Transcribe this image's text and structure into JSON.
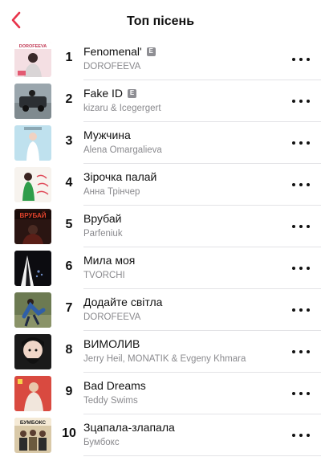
{
  "header": {
    "title": "Топ пісень",
    "back_icon": "chevron-left-icon",
    "accent": "#e8334a"
  },
  "explicit_badge": "E",
  "more_icon": "ellipsis-icon",
  "songs": [
    {
      "rank": "1",
      "title": "Fenomenal'",
      "artist": "DOROFEEVA",
      "explicit": true,
      "art_label": "DOROFEEVA",
      "art_bg": "#f4dfe3",
      "art_fg": "#c23a55"
    },
    {
      "rank": "2",
      "title": "Fake ID",
      "artist": "kizaru & Icegergert",
      "explicit": true,
      "art_label": "",
      "art_bg": "#9aa6ad",
      "art_fg": "#2b2f33"
    },
    {
      "rank": "3",
      "title": "Мужчина",
      "artist": "Alena Omargalieva",
      "explicit": false,
      "art_label": "",
      "art_bg": "#bfe1ee",
      "art_fg": "#ffffff"
    },
    {
      "rank": "4",
      "title": "Зірочка палай",
      "artist": "Анна Трінчер",
      "explicit": false,
      "art_label": "",
      "art_bg": "#f7f3ee",
      "art_fg": "#2f9d4a"
    },
    {
      "rank": "5",
      "title": "Врубай",
      "artist": "Parfeniuk",
      "explicit": false,
      "art_label": "ВРУБАЙ",
      "art_bg": "#2a1512",
      "art_fg": "#e0432c"
    },
    {
      "rank": "6",
      "title": "Мила моя",
      "artist": "TVORCHI",
      "explicit": false,
      "art_label": "",
      "art_bg": "#0c0c10",
      "art_fg": "#6f8cc4"
    },
    {
      "rank": "7",
      "title": "Додайте світла",
      "artist": "DOROFEEVA",
      "explicit": false,
      "art_label": "",
      "art_bg": "#6c7a52",
      "art_fg": "#2f5fa8"
    },
    {
      "rank": "8",
      "title": "ВИМОЛИВ",
      "artist": "Jerry Heil, MONATIK & Evgeny Khmara",
      "explicit": false,
      "art_label": "",
      "art_bg": "#1a1a1a",
      "art_fg": "#ffffff"
    },
    {
      "rank": "9",
      "title": "Bad Dreams",
      "artist": "Teddy Swims",
      "explicit": false,
      "art_label": "",
      "art_bg": "#d94a40",
      "art_fg": "#f1e6dc"
    },
    {
      "rank": "10",
      "title": "Зцапала-злапала",
      "artist": "Бумбокс",
      "explicit": false,
      "art_label": "БУМБОКС",
      "art_bg": "#d9c9a8",
      "art_fg": "#1c1c1c"
    }
  ]
}
